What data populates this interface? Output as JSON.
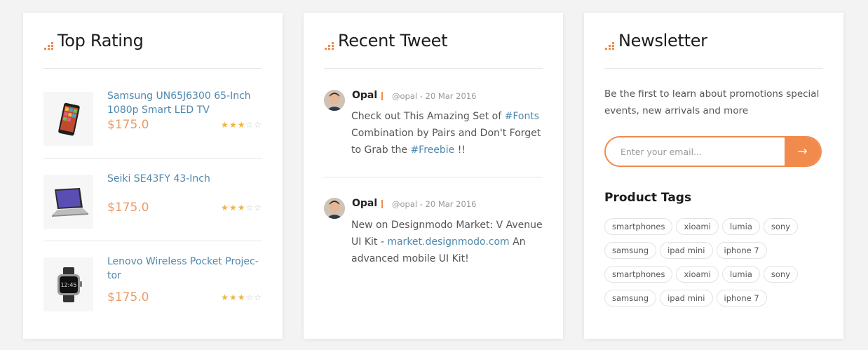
{
  "top_rating": {
    "title": "Top Rating",
    "products": [
      {
        "name": "Samsung UN65J6300 65-Inch 1080p Smart LED TV",
        "price": "$175.0",
        "rating": 3,
        "max_rating": 5,
        "icon": "tablet-icon"
      },
      {
        "name": "Seiki SE43FY 43-Inch",
        "price": "$175.0",
        "rating": 3,
        "max_rating": 5,
        "icon": "laptop-icon"
      },
      {
        "name": "Lenovo Wireless Pocket Projec-tor",
        "price": "$175.0",
        "rating": 3,
        "max_rating": 5,
        "icon": "smartwatch-icon"
      }
    ]
  },
  "recent_tweet": {
    "title": "Recent Tweet",
    "tweets": [
      {
        "author": "Opal",
        "handle": "@opal - 20 Mar 2016",
        "text_1": "Check out This Amazing Set of ",
        "link_1": "#Fonts",
        "text_2": " Combination by Pairs and Don't Forget to Grab the ",
        "link_2": "#Freebie",
        "text_3": " !!"
      },
      {
        "author": "Opal",
        "handle": "@opal - 20 Mar 2016",
        "text_1": "New on Designmodo Market: V Avenue UI Kit - ",
        "link_1": "market.designmodo.com",
        "text_2": " An advanced mobile UI Kit!"
      }
    ]
  },
  "newsletter": {
    "title": "Newsletter",
    "description": "Be the first to learn about promotions special events, new arrivals and more",
    "email_placeholder": "Enter your email...",
    "submit_label": "→",
    "tags_title": "Product Tags",
    "tags": [
      "smartphones",
      "xioami",
      "lumia",
      "sony",
      "samsung",
      "ipad mini",
      "iphone 7",
      "smartphones",
      "xioami",
      "lumia",
      "sony",
      "samsung",
      "ipad mini",
      "iphone 7"
    ]
  },
  "colors": {
    "accent": "#f08b4d",
    "link": "#4f88ad",
    "price": "#ee9a62",
    "star": "#f2b43c"
  }
}
